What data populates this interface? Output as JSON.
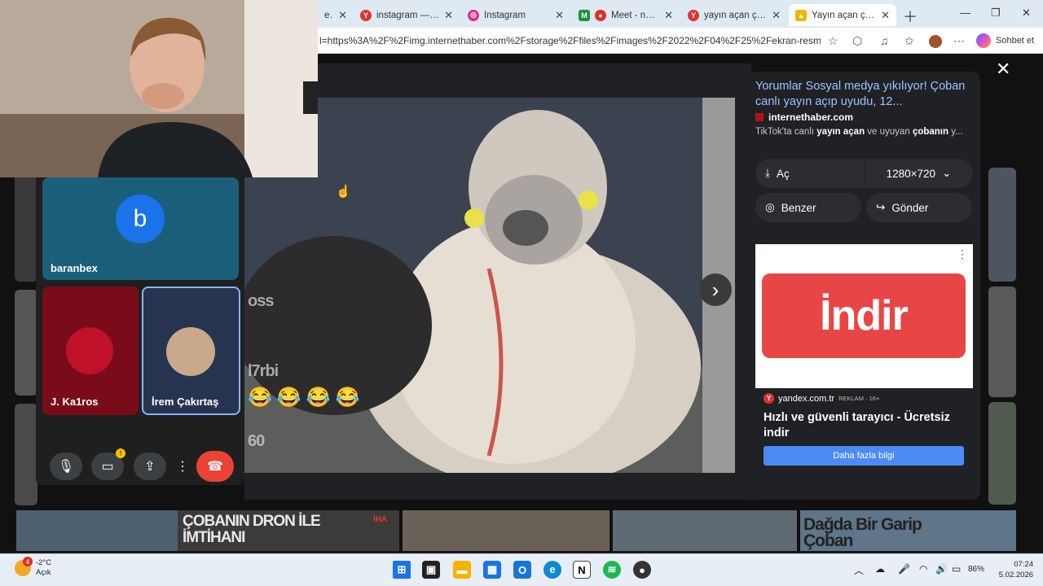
{
  "browser": {
    "tabs": [
      {
        "label": "erilin",
        "icon": "yandex-icon",
        "color": "#888888"
      },
      {
        "label": "instagram — Yande",
        "icon": "yandex-icon",
        "color": "#e0322f"
      },
      {
        "label": "Instagram",
        "icon": "instagram-icon",
        "color": "#d62f8a"
      },
      {
        "label": "Meet - nnm-d",
        "icon": "meet-icon",
        "color": "#d93025"
      },
      {
        "label": "yayın açan çoban –",
        "icon": "yandex-icon",
        "color": "#e0322f"
      },
      {
        "label": "Yayın açan çoban",
        "icon": "images-icon",
        "color": "#f4b400"
      }
    ],
    "url": "l=https%3A%2F%2Fimg.internethaber.com%2Fstorage%2Ffiles%2Fimages%2F2022%2F04%2F25%2Fekran-resmi-2022...",
    "copilot_label": "Sohbet et"
  },
  "viewer": {
    "overlay_texts": {
      "handle1": "oss",
      "handle2": "l7rbi",
      "count": "60"
    },
    "emojis": [
      "😂",
      "😂",
      "😂",
      "😂"
    ]
  },
  "info": {
    "title": "Yorumlar Sosyal medya yıkılıyor! Çoban canlı yayın açıp uyudu, 12...",
    "domain": "internethaber.com",
    "snippet_pre": "TikTok'ta canlı ",
    "snippet_b1": "yayın açan",
    "snippet_mid": " ve uyuyan ",
    "snippet_b2": "çobanın",
    "snippet_post": " y...",
    "open_label": "Aç",
    "size_label": "1280×720",
    "similar_label": "Benzer",
    "send_label": "Gönder"
  },
  "ad": {
    "image_text": "İndir",
    "source": "yandex.com.tr",
    "tag": "REKLAM · 16+",
    "headline": "Hızlı ve güvenli tarayıcı - Ücretsiz indir",
    "cta": "Daha fazla bilgi"
  },
  "thumbnails": {
    "t2": "ÇOBANIN DRON İLE İMTİHANI",
    "t2_badge": "İHA",
    "t5": "Dağda Bir Garip Çoban"
  },
  "meet": {
    "participants": [
      {
        "name": "baranbex",
        "initial": "b"
      },
      {
        "name": "J. Ka1ros"
      },
      {
        "name": "İrem Çakırtaş"
      }
    ]
  },
  "taskbar": {
    "weather_temp": "-2°C",
    "weather_desc": "Açık",
    "weather_badge": "4",
    "battery": "86%",
    "time": "07:24",
    "date": "5.02.2026"
  }
}
